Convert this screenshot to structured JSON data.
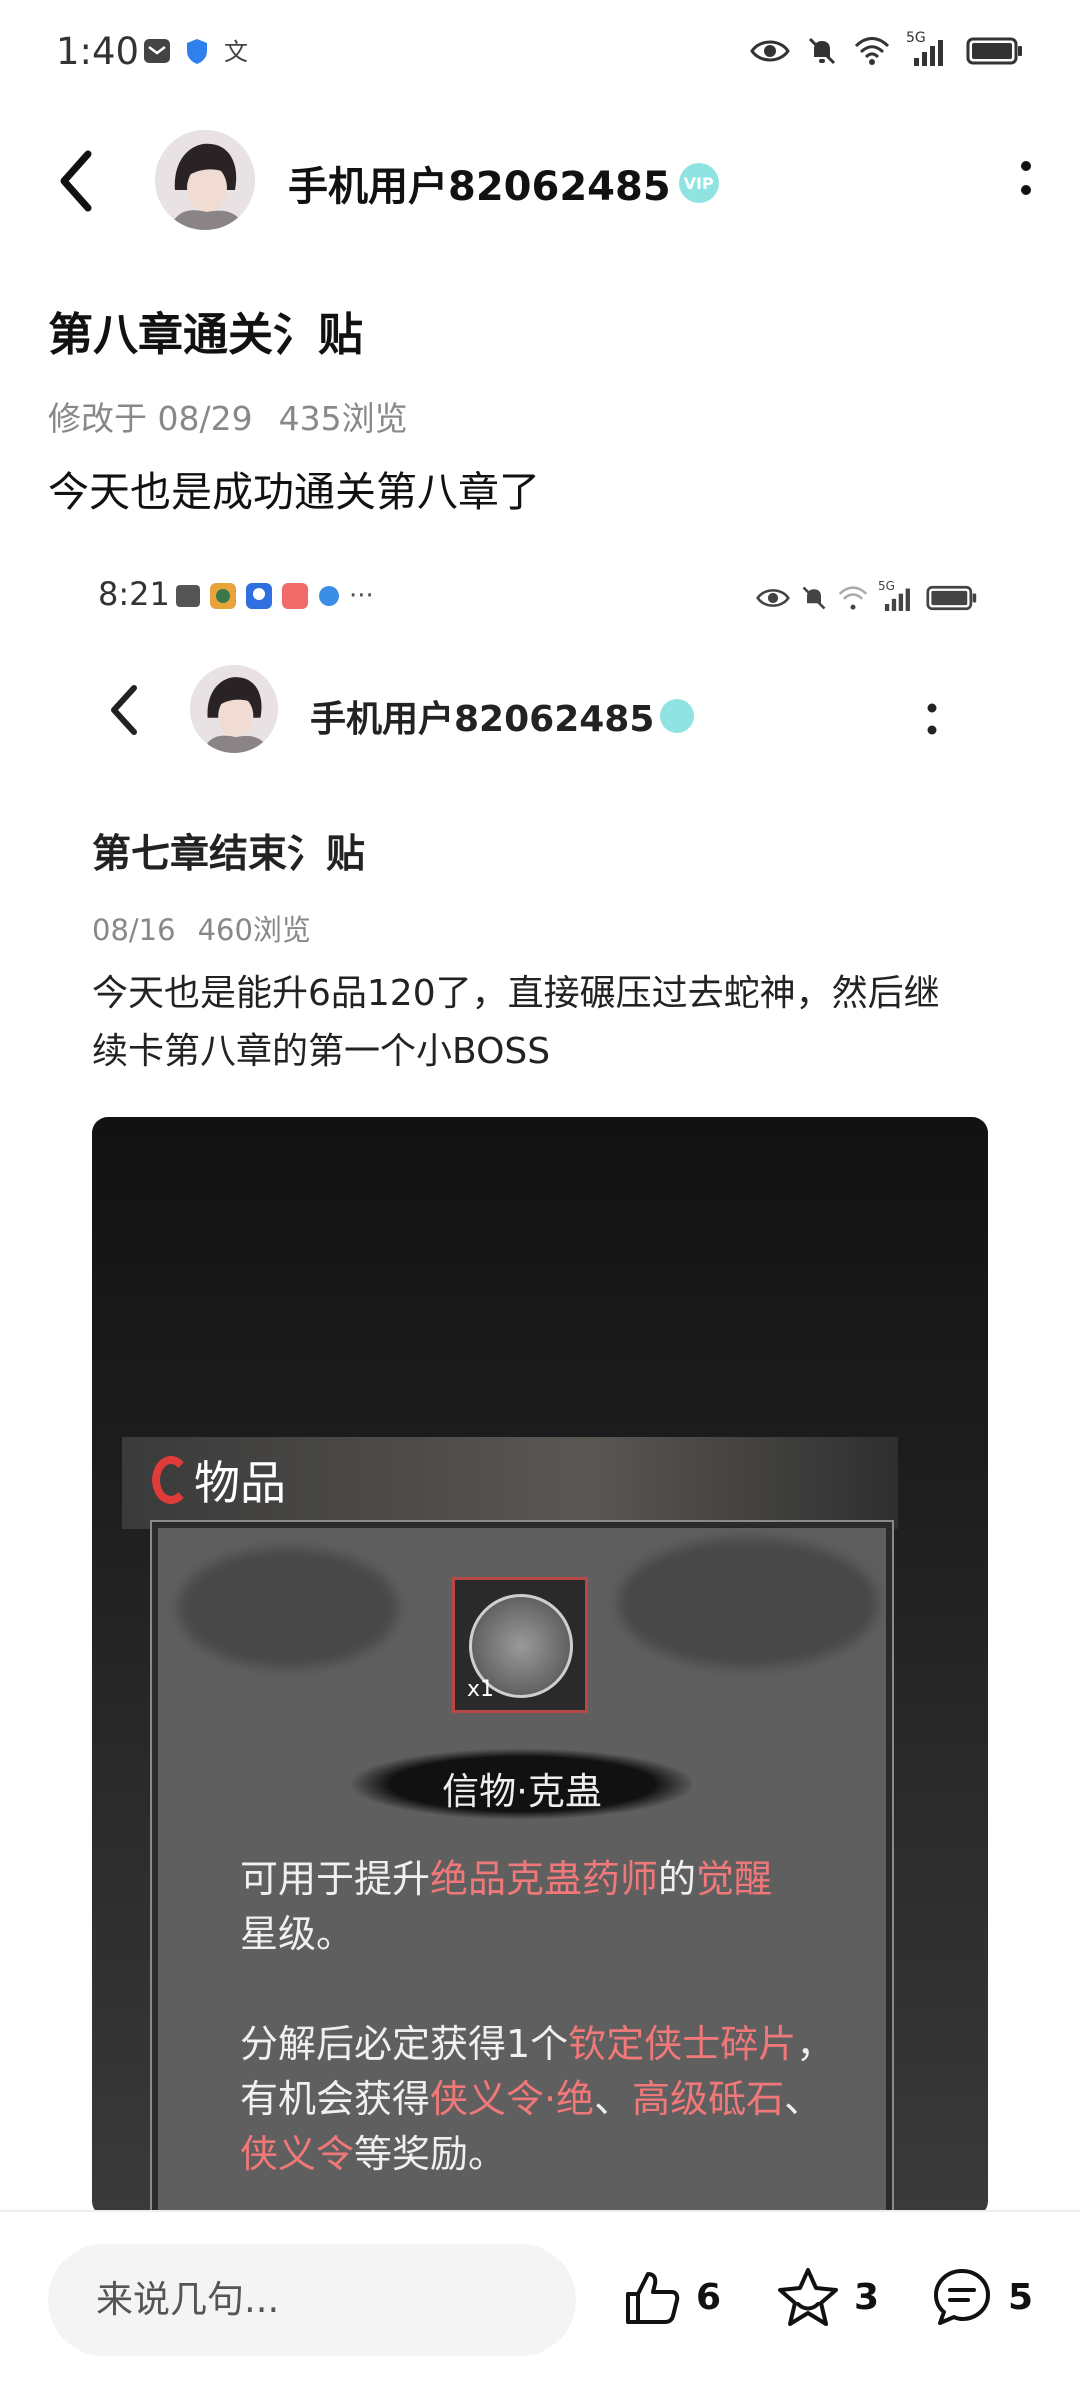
{
  "status_bar": {
    "time": "1:40",
    "network": "5G"
  },
  "header": {
    "username": "手机用户82062485",
    "badge": "VIP"
  },
  "post": {
    "title": "第八章通关氵贴",
    "meta_modified": "修改于 08/29",
    "meta_views": "435浏览",
    "body": "今天也是成功通关第八章了"
  },
  "embedded_screenshot": {
    "status_time": "8:21",
    "status_more": "···",
    "network": "5G",
    "username": "手机用户82062485",
    "title": "第七章结束氵贴",
    "meta_date": "08/16",
    "meta_views": "460浏览",
    "body": "今天也是能升6品120了，直接碾压过去蛇神，然后继续卡第八章的第一个小BOSS",
    "game": {
      "panel_title": "物品",
      "item_count": "x1",
      "item_name": "信物·克蛊",
      "desc1": {
        "a": "可用于提升",
        "b": "绝品克蛊药师",
        "c": "的",
        "d": "觉醒",
        "e": "星级。"
      },
      "desc2": {
        "a": "分解后必定获得1个",
        "b": "钦定侠士碎片",
        "c": "，有机会获得",
        "d": "侠义令·绝",
        "e": "、",
        "f": "高级砥石",
        "g": "、",
        "h": "侠义令",
        "i": "等奖励。"
      }
    }
  },
  "bottom_bar": {
    "comment_placeholder": "来说几句...",
    "likes": "6",
    "favorites": "3",
    "comments": "5"
  },
  "colors": {
    "accent_red": "#f07878",
    "badge_cyan": "#8fe3e0"
  }
}
